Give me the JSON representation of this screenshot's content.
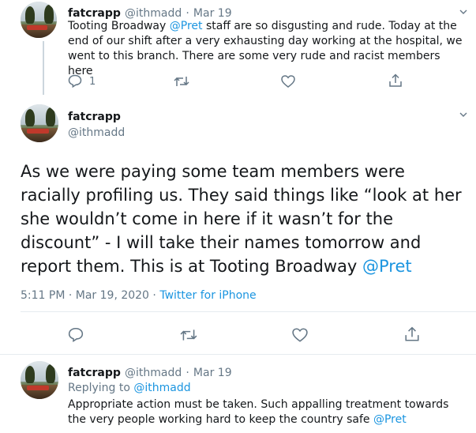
{
  "tweet1": {
    "name": "fatcrapp",
    "handle": "@ithmadd",
    "sep": "·",
    "date": "Mar 19",
    "text_before": "Tooting Broadway ",
    "mention": "@Pret",
    "text_after": " staff are so disgusting and rude. Today at the end of our shift after a very exhausting day working at the hospital, we went to this branch. There are some very rude and racist members here",
    "reply_count": "1"
  },
  "tweet2": {
    "name": "fatcrapp",
    "handle": "@ithmadd",
    "text_main": "As we were paying some team members were racially profiling us. They said things like “look at her she wouldn’t come in here if it wasn’t for the discount” - I will take their names tomorrow and report them. This is at Tooting Broadway ",
    "mention": "@Pret",
    "timestamp": "5:11 PM · Mar 19, 2020",
    "sep": " · ",
    "source": "Twitter for iPhone"
  },
  "tweet3": {
    "name": "fatcrapp",
    "handle": "@ithmadd",
    "sep": "·",
    "date": "Mar 19",
    "replying_label": "Replying to ",
    "replying_handle": "@ithmadd",
    "text_before": "Appropriate action must be taken. Such appalling treatment towards the very people working hard to keep the country safe ",
    "mention": "@Pret"
  },
  "icons": [
    "chevron-down-icon",
    "reply-icon",
    "retweet-icon",
    "like-icon",
    "share-icon"
  ],
  "colors": {
    "link": "#1b95e0",
    "secondary": "#657786",
    "text": "#14171a",
    "divider": "#e6ecf0"
  }
}
